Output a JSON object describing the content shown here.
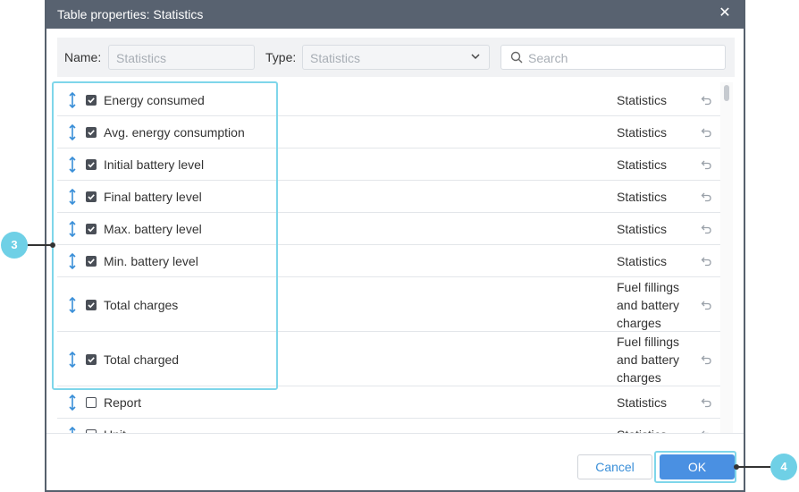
{
  "dialog": {
    "title": "Table properties: Statistics",
    "close_icon": "close-icon"
  },
  "toolbar": {
    "name_label": "Name:",
    "name_value": "Statistics",
    "type_label": "Type:",
    "type_value": "Statistics",
    "search_placeholder": "Search"
  },
  "columns": [
    {
      "name": "Energy consumed",
      "type": "Statistics",
      "checked": true
    },
    {
      "name": "Avg. energy consumption",
      "type": "Statistics",
      "checked": true
    },
    {
      "name": "Initial battery level",
      "type": "Statistics",
      "checked": true
    },
    {
      "name": "Final battery level",
      "type": "Statistics",
      "checked": true
    },
    {
      "name": "Max. battery level",
      "type": "Statistics",
      "checked": true
    },
    {
      "name": "Min. battery level",
      "type": "Statistics",
      "checked": true
    },
    {
      "name": "Total charges",
      "type_lines": [
        "Fuel fillings",
        "and battery",
        "charges"
      ],
      "checked": true
    },
    {
      "name": "Total charged",
      "type_lines": [
        "Fuel fillings",
        "and battery",
        "charges"
      ],
      "checked": true
    },
    {
      "name": "Report",
      "type": "Statistics",
      "checked": false
    },
    {
      "name": "Unit",
      "type": "Statistics",
      "checked": false
    }
  ],
  "buttons": {
    "cancel": "Cancel",
    "ok": "OK"
  },
  "callouts": {
    "c3": "3",
    "c4": "4"
  },
  "colors": {
    "titlebar": "#586270",
    "accent": "#4a90e2",
    "highlight": "#7fd6ea",
    "callout": "#6fd0e6"
  }
}
